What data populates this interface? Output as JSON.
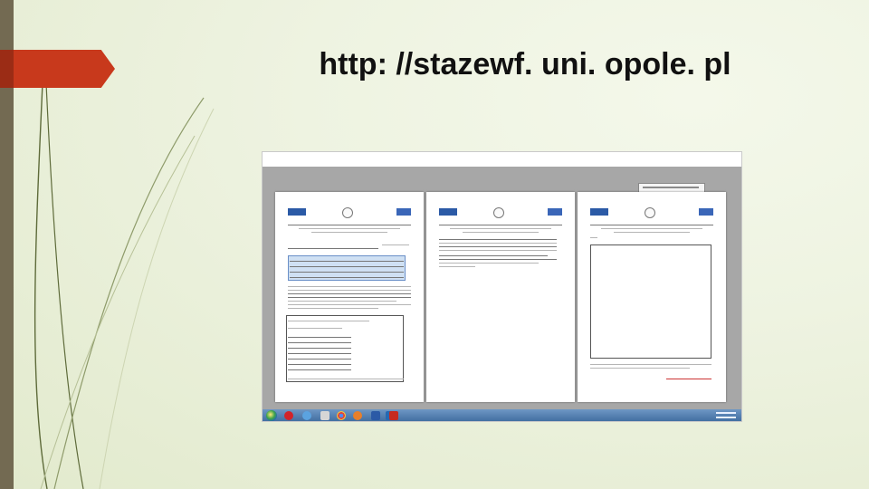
{
  "slide": {
    "title": "http: //stazewf. uni. opole. pl"
  },
  "colors": {
    "background": "#eef3e1",
    "left_bar": "#736a52",
    "accent_tab": "#c8391c",
    "taskbar": "#4f7fb3"
  },
  "screenshot": {
    "description_icons": [
      "windows-start-icon",
      "opera-icon",
      "ie-icon",
      "chrome-icon",
      "firefox-icon",
      "explorer-icon",
      "word-icon",
      "outlook-icon",
      "acrobat-icon"
    ]
  }
}
